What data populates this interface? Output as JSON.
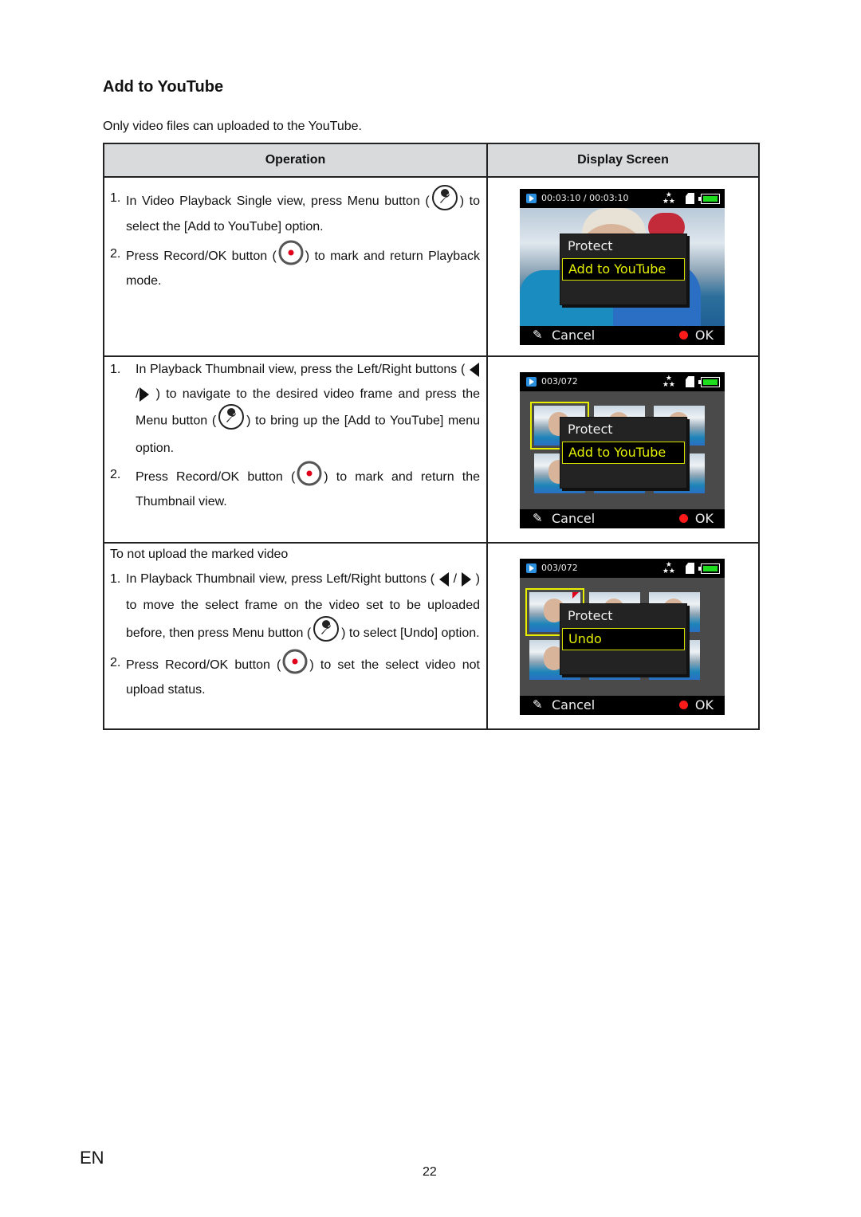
{
  "page": {
    "title": "Add to YouTube",
    "intro": "Only video files can uploaded to the YouTube.",
    "language": "EN",
    "page_number": "22"
  },
  "table": {
    "headers": {
      "operation": "Operation",
      "display": "Display Screen"
    },
    "rows": [
      {
        "steps": [
          {
            "num": "1.",
            "before": "In Video Playback Single view, press Menu button (",
            "icon": "wrench-icon",
            "after": ") to select the [Add to YouTube] option."
          },
          {
            "num": "2.",
            "before": "Press Record/OK button (",
            "icon": "record-icon",
            "after": ") to mark and return Playback mode."
          }
        ],
        "screen": {
          "counter": "00:03:10 / 00:03:10",
          "view": "single",
          "menu_items": [
            "Protect",
            "Add to YouTube"
          ],
          "cancel_label": "Cancel",
          "ok_label": "OK"
        }
      },
      {
        "steps": [
          {
            "num": "1.",
            "before": "In Playback Thumbnail view, press the Left/Right buttons (",
            "mid": ") to navigate to the desired video frame and press the Menu button (",
            "after": ") to bring up the [Add to YouTube] menu option."
          },
          {
            "num": "2.",
            "before": "Press Record/OK button (",
            "after": ") to mark and return the Thumbnail view."
          }
        ],
        "screen": {
          "counter": "003/072",
          "view": "thumbnail",
          "menu_items": [
            "Protect",
            "Add to YouTube"
          ],
          "cancel_label": "Cancel",
          "ok_label": "OK"
        }
      },
      {
        "heading": "To not upload the marked video",
        "steps": [
          {
            "num": "1.",
            "before": "In Playback Thumbnail view, press Left/Right buttons (",
            "mid": ") to move the select frame on the video set to be uploaded before, then press Menu button (",
            "after": ") to select [Undo] option."
          },
          {
            "num": "2.",
            "before": "Press Record/OK button (",
            "after": ") to set the select video not upload status."
          }
        ],
        "screen": {
          "counter": "003/072",
          "view": "thumbnail",
          "menu_items": [
            "Protect",
            "Undo"
          ],
          "cancel_label": "Cancel",
          "ok_label": "OK"
        }
      }
    ]
  },
  "colors": {
    "header_bg": "#d9dadc",
    "menu_highlight": "#e4f000",
    "record_red": "#ff1a1a",
    "battery_green": "#1fdc1f",
    "play_blue": "#2b8fe0"
  },
  "icons": {
    "wrench": "🔧",
    "stars": "★\n★★"
  }
}
